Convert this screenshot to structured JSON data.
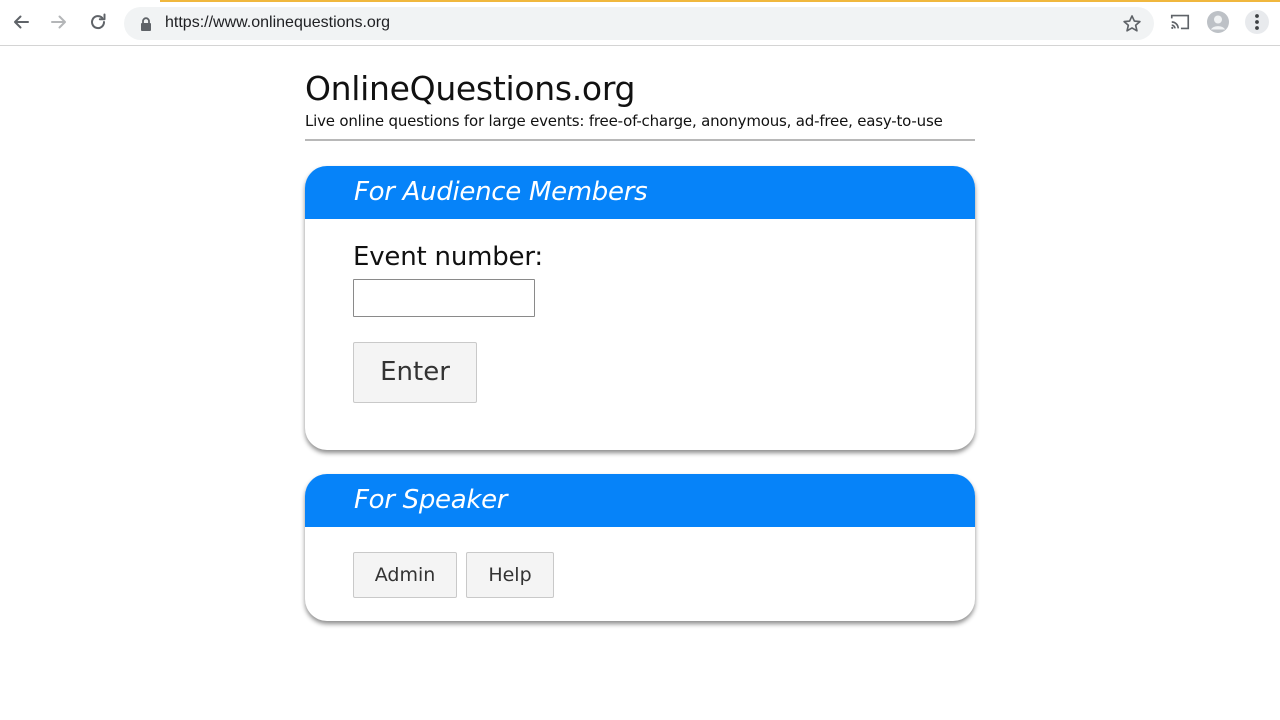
{
  "browser": {
    "url": "https://www.onlinequestions.org",
    "icons": {
      "back": "arrow-left-icon",
      "forward": "arrow-right-icon",
      "reload": "reload-icon",
      "lock": "lock-icon",
      "bookmark": "star-icon",
      "cast": "cast-icon",
      "profile": "profile-icon",
      "menu": "kebab-menu-icon"
    },
    "colors": {
      "loading_bar": "#f0b73d",
      "omnibox_bg": "#f1f3f4"
    }
  },
  "site": {
    "title": "OnlineQuestions.org",
    "tagline": "Live online questions for large events: free-of-charge, anonymous, ad-free, easy-to-use"
  },
  "audience_panel": {
    "heading": "For Audience Members",
    "event_label": "Event number:",
    "event_value": "",
    "enter_label": "Enter"
  },
  "speaker_panel": {
    "heading": "For Speaker",
    "admin_label": "Admin",
    "help_label": "Help"
  },
  "colors": {
    "panel_header": "#0683f9"
  }
}
